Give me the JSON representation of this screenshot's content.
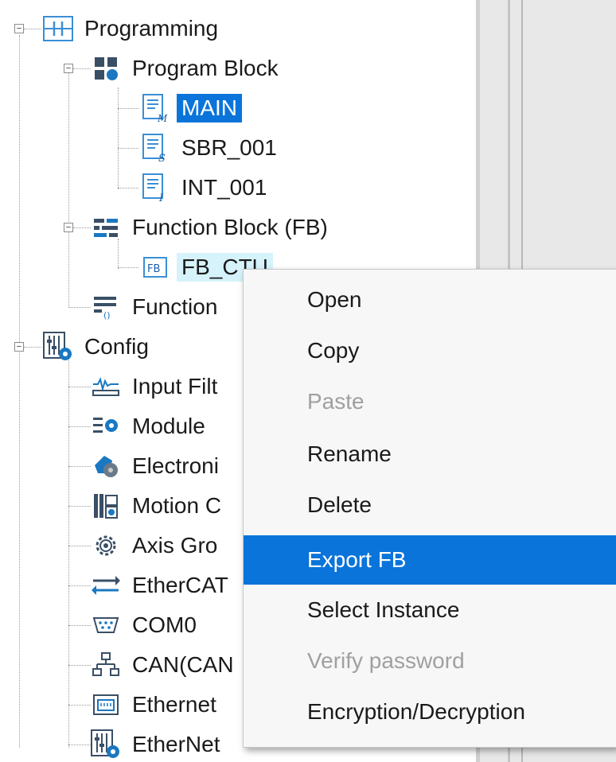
{
  "tree": {
    "programming": "Programming",
    "program_block": "Program Block",
    "main": "MAIN",
    "sbr": "SBR_001",
    "int": "INT_001",
    "function_block": "Function Block (FB)",
    "fb_ctu": "FB_CTU",
    "function": "Function",
    "config": "Config",
    "input_filter": "Input Filt",
    "module": "Module",
    "electronic": "Electroni",
    "motion": "Motion C",
    "axis_group": "Axis Gro",
    "ethercat": "EtherCAT",
    "com0": "COM0",
    "can": "CAN(CAN",
    "ethernet": "Ethernet",
    "ethernet_ip": "EtherNet"
  },
  "menu": {
    "open": "Open",
    "copy": "Copy",
    "paste": "Paste",
    "rename": "Rename",
    "delete": "Delete",
    "export_fb": "Export FB",
    "select_instance": "Select Instance",
    "verify_password": "Verify password",
    "encryption": "Encryption/Decryption"
  },
  "colors": {
    "selection": "#0a74da",
    "hover": "#d6f3fb",
    "icon_dark": "#3a4f66",
    "icon_blue": "#1a78c2"
  }
}
